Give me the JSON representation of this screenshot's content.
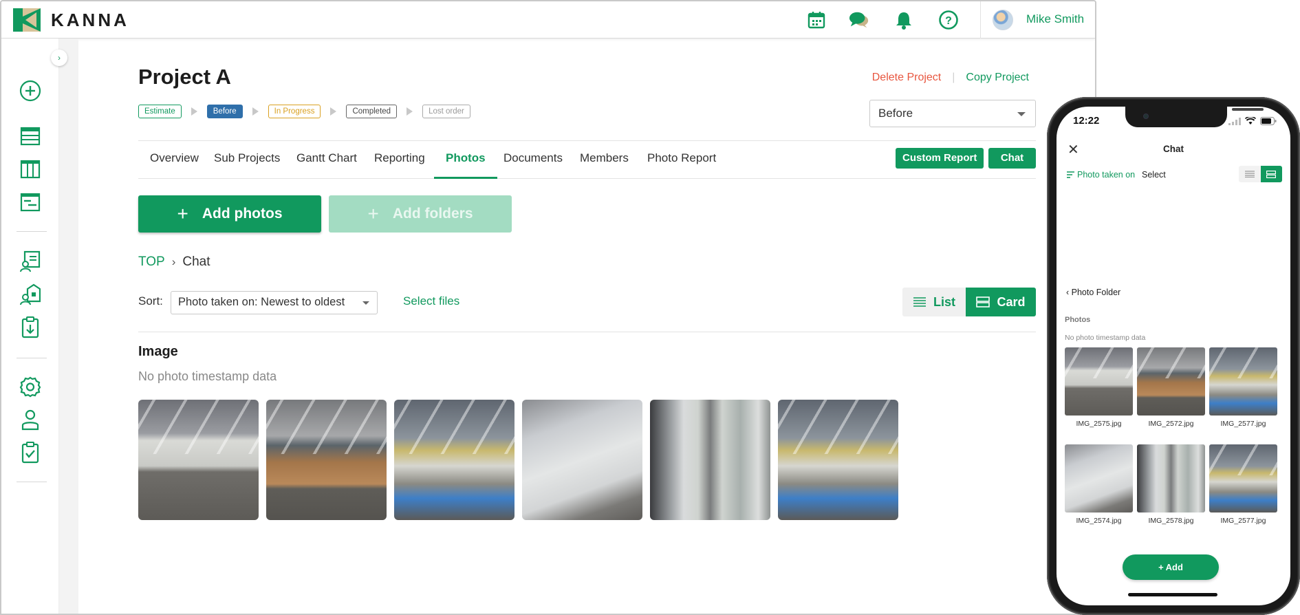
{
  "app": {
    "brand": "KANNA",
    "user_name": "Mike Smith"
  },
  "colors": {
    "accent": "#11995e",
    "danger": "#e8563f",
    "before_badge": "#2f6faa",
    "in_progress": "#d9a020"
  },
  "topbar": {
    "icons": [
      "calendar-icon",
      "chat-bubbles-icon",
      "bell-icon",
      "help-icon"
    ]
  },
  "sidebar": {
    "icons": [
      "add-circle-icon",
      "list-icon",
      "board-icon",
      "gantt-icon",
      "customer-icon",
      "property-icon",
      "report-download-icon",
      "settings-icon",
      "user-icon",
      "checklist-icon"
    ]
  },
  "project": {
    "title": "Project A",
    "delete_label": "Delete Project",
    "copy_label": "Copy Project",
    "stages": [
      "Estimate",
      "Before",
      "In Progress",
      "Completed",
      "Lost order"
    ],
    "status_value": "Before"
  },
  "tabs": [
    "Overview",
    "Sub Projects",
    "Gantt Chart",
    "Reporting",
    "Photos",
    "Documents",
    "Members",
    "Photo Report"
  ],
  "active_tab": "Photos",
  "actions": {
    "custom_report": "Custom Report",
    "chat": "Chat",
    "add_photos": "Add photos",
    "add_folders": "Add folders"
  },
  "breadcrumb": {
    "root": "TOP",
    "current": "Chat"
  },
  "sort": {
    "label": "Sort:",
    "value": "Photo taken on: Newest to oldest",
    "select_files": "Select files"
  },
  "view": {
    "list": "List",
    "card": "Card",
    "active": "Card"
  },
  "gallery": {
    "heading": "Image",
    "subheading": "No photo timestamp data",
    "photo_count": 6
  },
  "phone": {
    "time": "12:22",
    "title": "Chat",
    "sort_label": "Photo taken on",
    "select_label": "Select",
    "back_label": "Photo Folder",
    "section": "Photos",
    "subsection": "No photo timestamp data",
    "photos": [
      "IMG_2575.jpg",
      "IMG_2572.jpg",
      "IMG_2577.jpg",
      "IMG_2574.jpg",
      "IMG_2578.jpg",
      "IMG_2577.jpg"
    ],
    "add_label": "Add"
  }
}
